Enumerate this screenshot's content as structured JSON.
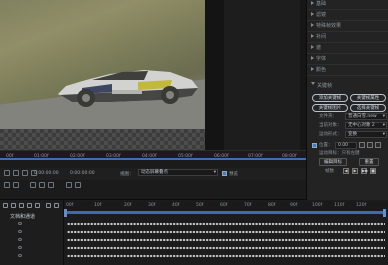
{
  "viewer": {
    "image_desc_icon": "race-car-frame"
  },
  "properties": {
    "sections": [
      "基础",
      "滤镜",
      "特殊帧效果",
      "补间",
      "遮",
      "字体",
      "颜色",
      "关键帧"
    ],
    "buttons": [
      "添加关键帧",
      "关键帧属性",
      "关键帧图片",
      "选择关键帧"
    ],
    "fields": [
      {
        "label": "文件夹：",
        "value": "普通白雪.new"
      },
      {
        "label": "当前对象：",
        "value": "无中心对象 2"
      },
      {
        "label": "运动形式：",
        "value": "变换"
      }
    ],
    "position_label": "位置：",
    "position_value": "0.00",
    "follow_label": "运动目标：只有左键",
    "edit_target_button": "编辑目标",
    "reset_button": "重置",
    "frame_label": "帧数",
    "play_buttons": [
      "◀",
      "▶",
      "▶▶",
      "■"
    ]
  },
  "ruler": {
    "ticks": [
      "00f",
      "01:00f",
      "02:00f",
      "03:00f",
      "04:00f",
      "05:00f",
      "06:00f",
      "07:00f",
      "08:00f"
    ]
  },
  "controls": {
    "timecode1": "0:00:00:00",
    "timecode2": "0:00:00:00",
    "view_label": "视图：",
    "view_value": "动态屏幕叠点",
    "preview_label": "预览"
  },
  "timeline": {
    "layer_label": "文档和通道",
    "ruler_ticks": [
      "00f",
      "10f",
      "20f",
      "30f",
      "40f",
      "50f",
      "60f",
      "70f",
      "80f",
      "90f",
      "100f",
      "110f",
      "120f",
      "130f"
    ]
  },
  "colors": {
    "accent": "#3f6fb0",
    "keyframe_dot": "#c8c8c8"
  }
}
